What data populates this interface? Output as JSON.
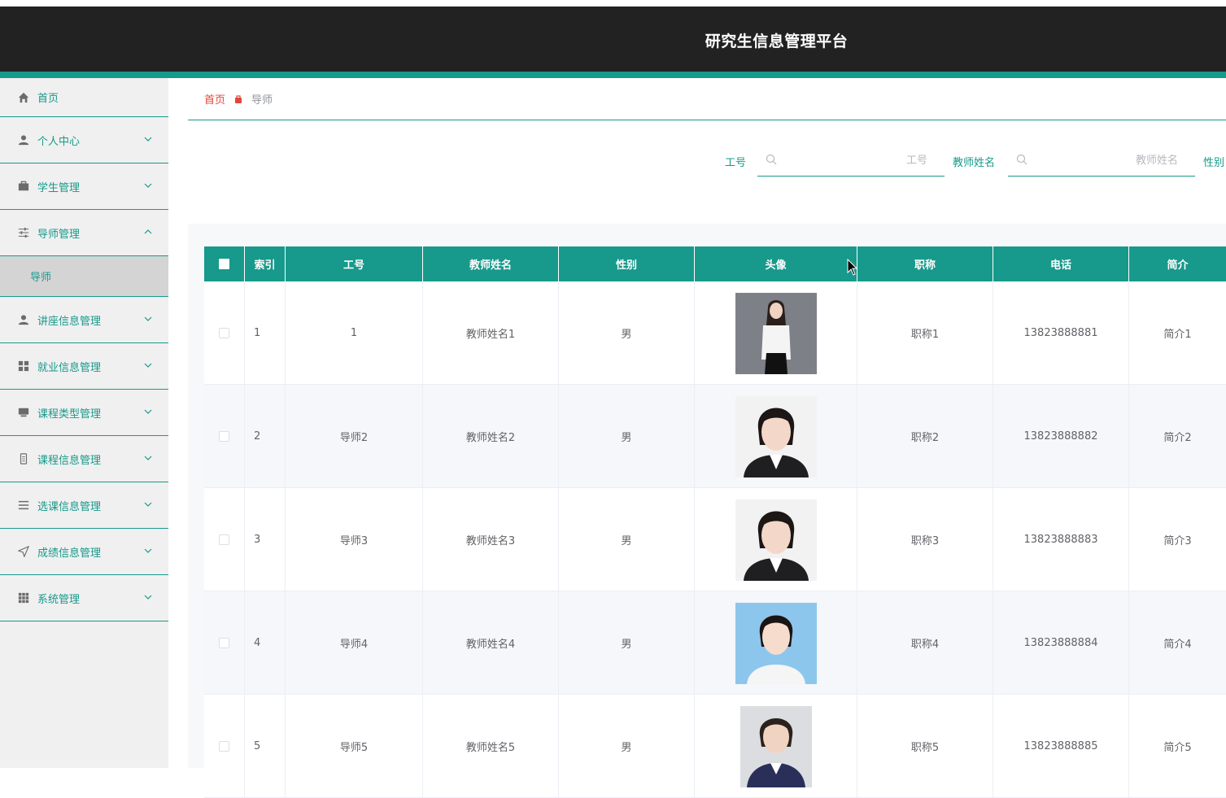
{
  "header": {
    "title": "研究生信息管理平台"
  },
  "sidebar": {
    "items": [
      {
        "label": "首页",
        "icon": "home-icon",
        "expandable": false
      },
      {
        "label": "个人中心",
        "icon": "user-icon",
        "expandable": true
      },
      {
        "label": "学生管理",
        "icon": "briefcase-icon",
        "expandable": true
      },
      {
        "label": "导师管理",
        "icon": "sliders-icon",
        "expandable": true,
        "expanded": true,
        "children": [
          {
            "label": "导师"
          }
        ]
      },
      {
        "label": "讲座信息管理",
        "icon": "user-icon",
        "expandable": true
      },
      {
        "label": "就业信息管理",
        "icon": "grid-icon",
        "expandable": true
      },
      {
        "label": "课程类型管理",
        "icon": "monitor-icon",
        "expandable": true
      },
      {
        "label": "课程信息管理",
        "icon": "document-icon",
        "expandable": true
      },
      {
        "label": "选课信息管理",
        "icon": "list-icon",
        "expandable": true
      },
      {
        "label": "成绩信息管理",
        "icon": "send-icon",
        "expandable": true
      },
      {
        "label": "系统管理",
        "icon": "apps-icon",
        "expandable": true
      }
    ]
  },
  "breadcrumb": {
    "home": "首页",
    "current": "导师"
  },
  "search": {
    "fields": [
      {
        "label": "工号",
        "placeholder": "工号",
        "value": ""
      },
      {
        "label": "教师姓名",
        "placeholder": "教师姓名",
        "value": ""
      },
      {
        "label": "性别"
      }
    ]
  },
  "table": {
    "columns": [
      "索引",
      "工号",
      "教师姓名",
      "性别",
      "头像",
      "职称",
      "电话",
      "简介"
    ],
    "rows": [
      {
        "index": "1",
        "id": "1",
        "name": "教师姓名1",
        "sex": "男",
        "avatar": "photo-1",
        "title": "职称1",
        "phone": "13823888881",
        "intro": "简介1"
      },
      {
        "index": "2",
        "id": "导师2",
        "name": "教师姓名2",
        "sex": "男",
        "avatar": "photo-2",
        "title": "职称2",
        "phone": "13823888882",
        "intro": "简介2"
      },
      {
        "index": "3",
        "id": "导师3",
        "name": "教师姓名3",
        "sex": "男",
        "avatar": "photo-3",
        "title": "职称3",
        "phone": "13823888883",
        "intro": "简介3"
      },
      {
        "index": "4",
        "id": "导师4",
        "name": "教师姓名4",
        "sex": "男",
        "avatar": "photo-4",
        "title": "职称4",
        "phone": "13823888884",
        "intro": "简介4"
      },
      {
        "index": "5",
        "id": "导师5",
        "name": "教师姓名5",
        "sex": "男",
        "avatar": "photo-5",
        "title": "职称5",
        "phone": "13823888885",
        "intro": "简介5"
      }
    ]
  },
  "colors": {
    "accent": "#17998b",
    "header_bg": "#222222",
    "sidebar_bg": "#f0f0f0",
    "breadcrumb_home": "#e0473a"
  }
}
